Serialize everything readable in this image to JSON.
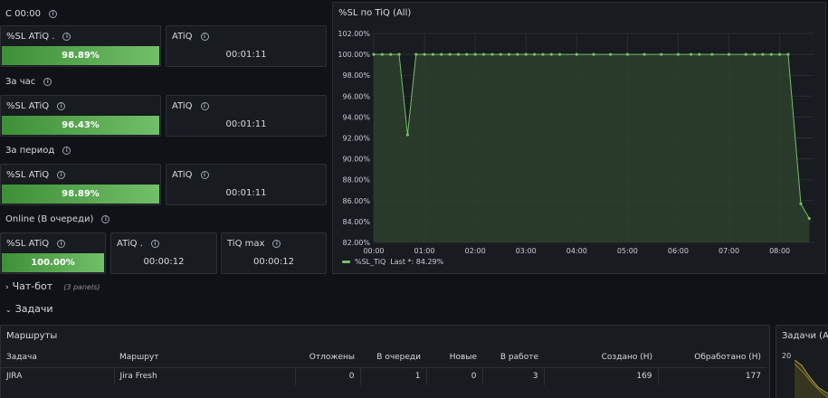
{
  "sections": {
    "since_midnight": "С 00:00",
    "per_hour": "За час",
    "per_period": "За период",
    "online": "Online (В очереди)"
  },
  "stats": {
    "row1": {
      "sl_title": "%SL ATiQ .",
      "sl_value": "98.89%",
      "sl_fraction": 0.9889,
      "atiq_title": "ATiQ",
      "atiq_value": "00:01:11"
    },
    "row2": {
      "sl_title": "%SL ATiQ",
      "sl_value": "96.43%",
      "sl_fraction": 0.9643,
      "atiq_title": "ATiQ",
      "atiq_value": "00:01:11"
    },
    "row3": {
      "sl_title": "%SL ATiQ",
      "sl_value": "98.89%",
      "sl_fraction": 0.9889,
      "atiq_title": "ATiQ",
      "atiq_value": "00:01:11"
    },
    "row4": {
      "sl_title": "%SL ATiQ",
      "sl_value": "100.00%",
      "sl_fraction": 1.0,
      "atiq_title": "ATiQ .",
      "atiq_value": "00:00:12",
      "tiqmax_title": "TiQ max",
      "tiqmax_value": "00:00:12"
    }
  },
  "graph_panel": {
    "title": "%SL по TiQ (All)",
    "legend_name": "%SL_TiQ",
    "legend_last": "Last *: 84.29%"
  },
  "chart_data": {
    "type": "area",
    "title": "%SL по TiQ (All)",
    "xlabel": "",
    "ylabel": "",
    "x_ticks": [
      "00:00",
      "01:00",
      "02:00",
      "03:00",
      "04:00",
      "05:00",
      "06:00",
      "07:00",
      "08:00"
    ],
    "y_ticks": [
      "82.00%",
      "84.00%",
      "86.00%",
      "88.00%",
      "90.00%",
      "92.00%",
      "94.00%",
      "96.00%",
      "98.00%",
      "100.00%",
      "102.00%"
    ],
    "ylim": [
      82,
      102
    ],
    "xlim_minutes": [
      0,
      520
    ],
    "grid": true,
    "legend": "bottom-left",
    "colors": {
      "line": "#73bf69",
      "fill": "#2e3f2d"
    },
    "series": [
      {
        "name": "%SL_TiQ",
        "x_minutes": [
          0,
          10,
          20,
          30,
          40,
          50,
          60,
          70,
          80,
          90,
          100,
          110,
          120,
          130,
          140,
          150,
          160,
          170,
          180,
          190,
          200,
          210,
          220,
          240,
          260,
          280,
          300,
          320,
          340,
          360,
          375,
          385,
          400,
          420,
          440,
          450,
          460,
          470,
          480,
          490,
          505,
          515
        ],
        "values": [
          100,
          100,
          100,
          100,
          92.3,
          100,
          100,
          100,
          100,
          100,
          100,
          100,
          100,
          100,
          100,
          100,
          100,
          100,
          100,
          100,
          100,
          100,
          100,
          100,
          100,
          100,
          100,
          100,
          100,
          100,
          100,
          100,
          100,
          100,
          100,
          100,
          100,
          100,
          100,
          100,
          85.7,
          84.29
        ]
      }
    ]
  },
  "chatbot_row": {
    "title": "Чат-бот",
    "count": "(3 panels)"
  },
  "tasks_row": {
    "title": "Задачи"
  },
  "routes_table": {
    "title": "Маршруты",
    "columns": [
      "Задача",
      "Маршрут",
      "Отложены",
      "В очереди",
      "Новые",
      "В работе",
      "Создано (Н)",
      "Обработано (Н)"
    ],
    "rows": [
      [
        "JIRA",
        "Jira Fresh",
        "0",
        "1",
        "0",
        "3",
        "169",
        "177"
      ]
    ]
  },
  "side_panel": {
    "title": "Задачи (All",
    "y_tick": "20"
  }
}
